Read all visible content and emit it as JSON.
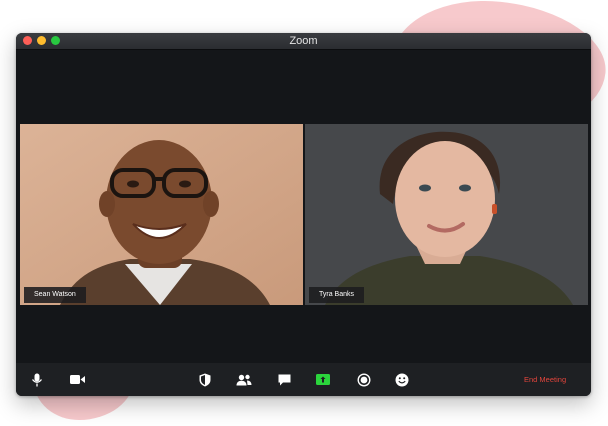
{
  "window": {
    "title": "Zoom"
  },
  "participants": [
    {
      "name": "Sean Watson"
    },
    {
      "name": "Tyra Banks"
    }
  ],
  "toolbar": {
    "icons": [
      "microphone-icon",
      "video-camera-icon",
      "security-shield-icon",
      "participants-icon",
      "chat-icon",
      "share-screen-icon",
      "record-icon",
      "reactions-icon"
    ],
    "share_icon_color": "#2bd53c",
    "end_meeting_label": "End Meeting",
    "end_meeting_color": "#e2453c"
  },
  "colors": {
    "window_background": "#141619",
    "accent_blob": "#f7c9cc"
  }
}
